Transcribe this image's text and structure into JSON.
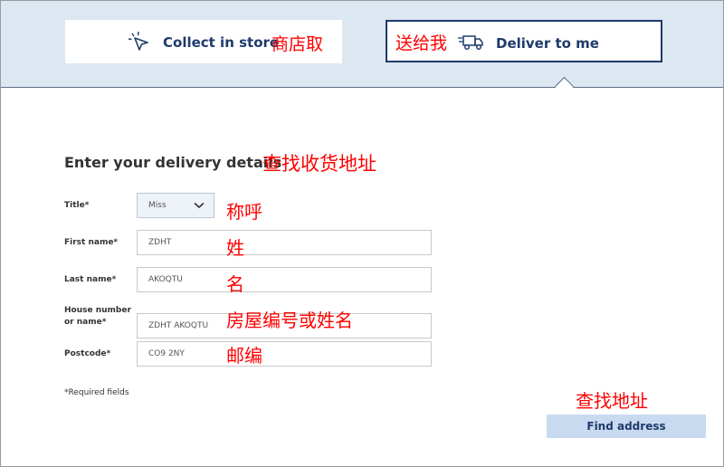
{
  "options": {
    "collect": {
      "label": "Collect in store",
      "note": "商店取",
      "icon": "cursor-sparkle-icon"
    },
    "deliver": {
      "label": "Deliver to me",
      "note": "送给我",
      "icon": "delivery-truck-icon",
      "selected": true
    }
  },
  "form": {
    "heading": "Enter your delivery details",
    "heading_note": "查找收货地址",
    "title": {
      "label": "Title*",
      "value": "Miss",
      "note": "称呼"
    },
    "first_name": {
      "label": "First name*",
      "value": "ZDHT",
      "note": "姓"
    },
    "last_name": {
      "label": "Last name*",
      "value": "AKOQTU",
      "note": "名"
    },
    "house": {
      "label_line1": "House number",
      "label_line2": "or name*",
      "value": "ZDHT AKOQTU",
      "note": "房屋编号或姓名"
    },
    "postcode": {
      "label": "Postcode*",
      "value": "CO9 2NY",
      "note": "邮编"
    },
    "required_note": "*Required fields"
  },
  "find": {
    "label": "Find address",
    "note": "查找地址"
  },
  "colors": {
    "brand_navy": "#1f3a6b",
    "band": "#dde7f2",
    "annotation": "#ff0000",
    "button": "#c7daf0"
  }
}
